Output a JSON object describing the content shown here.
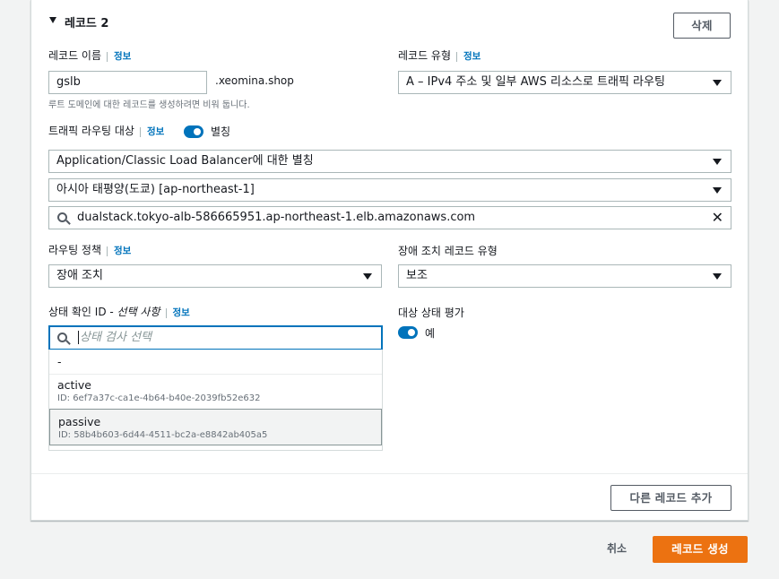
{
  "record": {
    "section_title": "레코드 2",
    "delete_label": "삭제",
    "name_label": "레코드 이름",
    "info_label": "정보",
    "name_value": "gslb",
    "domain_suffix": ".xeomina.shop",
    "name_hint": "루트 도메인에 대한 레코드를 생성하려면 비워 둡니다.",
    "type_label": "레코드 유형",
    "type_value": "A – IPv4 주소 및 일부 AWS 리소스로 트래픽 라우팅",
    "traffic_target_label": "트래픽 라우팅 대상",
    "alias_label": "별칭",
    "alias_endpoint": "Application/Classic Load Balancer에 대한 별칭",
    "region": "아시아 태평양(도쿄) [ap-northeast-1]",
    "lb_value": "dualstack.tokyo-alb-586665951.ap-northeast-1.elb.amazonaws.com",
    "routing_policy_label": "라우팅 정책",
    "routing_policy_value": "장애 조치",
    "failover_type_label": "장애 조치 레코드 유형",
    "failover_type_value": "보조",
    "health_check_label": "상태 확인 ID - ",
    "health_check_optional": "선택 사항",
    "health_check_placeholder": "상태 검사 선택",
    "evaluate_health_label": "대상 상태 평가",
    "evaluate_health_value": "예",
    "options": [
      {
        "title": "-",
        "id": ""
      },
      {
        "title": "active",
        "id": "ID: 6ef7a37c-ca1e-4b64-b40e-2039fb52e632"
      },
      {
        "title": "passive",
        "id": "ID: 58b4b603-6d44-4511-bc2a-e8842ab405a5"
      }
    ],
    "add_record_label": "다른 레코드 추가"
  },
  "footer": {
    "cancel_label": "취소",
    "create_label": "레코드 생성"
  },
  "colors": {
    "accent": "#0073bb",
    "primary_button": "#ec7211",
    "selected_option_bg": "#f2f3f3"
  }
}
